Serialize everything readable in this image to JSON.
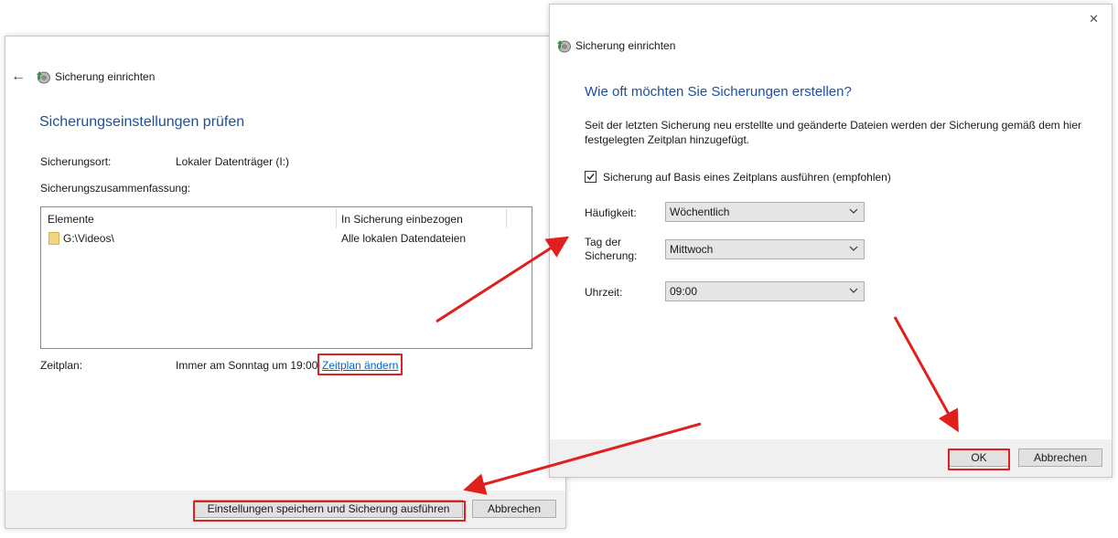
{
  "left_window": {
    "title": "Sicherung einrichten",
    "heading": "Sicherungseinstellungen prüfen",
    "location_label": "Sicherungsort:",
    "location_value": "Lokaler Datenträger (I:)",
    "summary_label": "Sicherungszusammenfassung:",
    "table": {
      "columns": [
        "Elemente",
        "In Sicherung einbezogen"
      ],
      "rows": [
        {
          "item": "G:\\Videos\\",
          "included": "Alle lokalen Datendateien"
        }
      ]
    },
    "schedule_label": "Zeitplan:",
    "schedule_value": "Immer am Sonntag um 19:00",
    "schedule_link": "Zeitplan ändern",
    "save_button": "Einstellungen speichern und Sicherung ausführen",
    "cancel_button": "Abbrechen"
  },
  "right_window": {
    "title": "Sicherung einrichten",
    "close_glyph": "✕",
    "heading": "Wie oft möchten Sie Sicherungen erstellen?",
    "description_line1": "Seit der letzten Sicherung neu erstellte und geänderte Dateien werden der Sicherung gemäß dem hier",
    "description_line2": "festgelegten Zeitplan hinzugefügt.",
    "checkbox_label": "Sicherung auf Basis eines Zeitplans ausführen (empfohlen)",
    "checkbox_checked": true,
    "frequency_label": "Häufigkeit:",
    "frequency_value": "Wöchentlich",
    "day_label_line1": "Tag der",
    "day_label_line2": "Sicherung:",
    "day_value": "Mittwoch",
    "time_label": "Uhrzeit:",
    "time_value": "09:00",
    "ok_button": "OK",
    "cancel_button": "Abbrechen"
  },
  "colors": {
    "heading_blue": "#1e4f9c",
    "link_blue": "#0066cc",
    "highlight_red": "#e0201c",
    "footer_gray": "#f0f0f0"
  }
}
